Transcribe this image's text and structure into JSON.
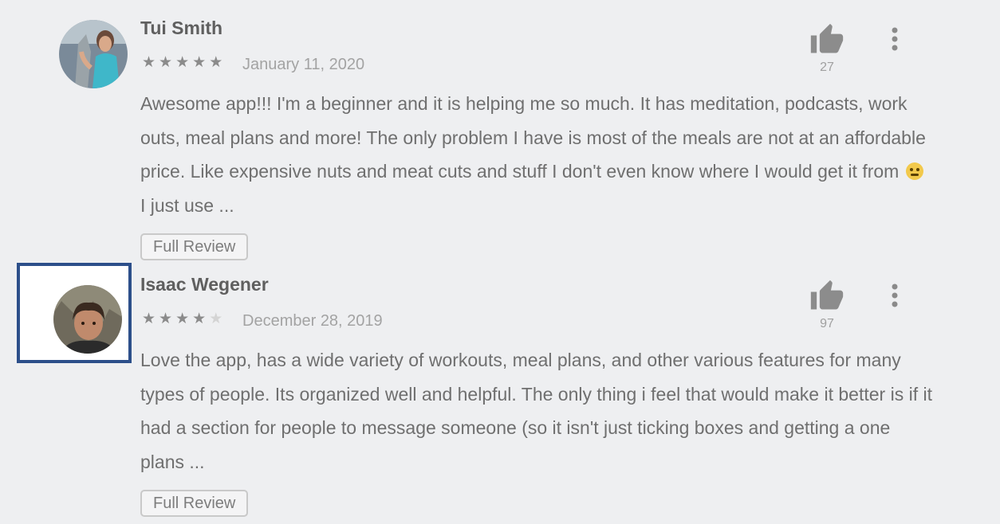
{
  "reviews": [
    {
      "author": "Tui Smith",
      "rating": 5,
      "max_rating": 5,
      "date": "January 11, 2020",
      "likes": "27",
      "text_before_emoji": "Awesome app!!! I'm a beginner and it is helping me so much. It has meditation, podcasts, work outs, meal plans and more! The only problem I have is most of the meals are not at an affordable price. Like expensive nuts and meat cuts and stuff I don't even know where I would get it from",
      "emoji": "thinking-face-emoji",
      "text_after_emoji": "I just use ...",
      "full_review_label": "Full Review"
    },
    {
      "author": "Isaac Wegener",
      "rating": 4,
      "max_rating": 5,
      "date": "December 28, 2019",
      "likes": "97",
      "text": "Love the app, has a wide variety of workouts, meal plans, and other various features for many types of people. Its organized well and helpful. The only thing i feel that would make it better is if it had a section for people to message someone (so it isn't just ticking boxes and getting a one plans ...",
      "full_review_label": "Full Review",
      "highlighted_avatar": true
    }
  ],
  "icons": {
    "like": "thumbs-up-icon",
    "more": "more-vertical-icon",
    "star": "star-icon"
  },
  "colors": {
    "background": "#eeeff1",
    "highlight_border": "#2c4f8a",
    "star_filled": "#8b8b8b",
    "star_empty": "#d4d4d4"
  }
}
